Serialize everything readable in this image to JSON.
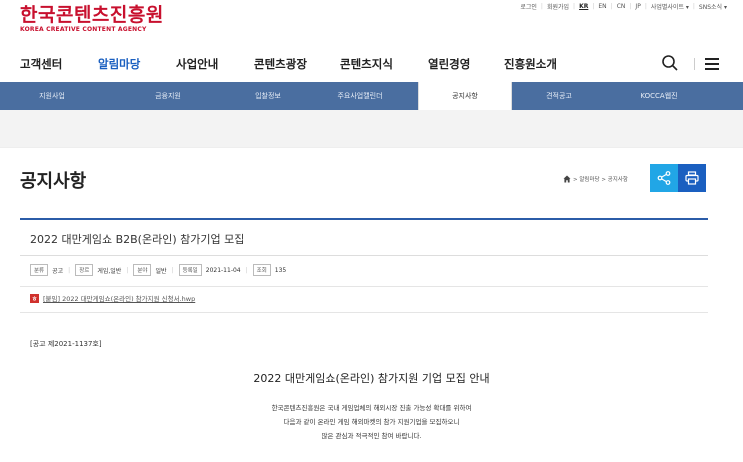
{
  "logo": {
    "ko": "한국콘텐츠진흥원",
    "en": "KOREA CREATIVE CONTENT AGENCY"
  },
  "util": [
    "로그인",
    "회원가입",
    "KR",
    "EN",
    "CN",
    "JP",
    "사업별사이트 ▾",
    "SNS소식 ▾"
  ],
  "gnb": [
    "고객센터",
    "알림마당",
    "사업안내",
    "콘텐츠광장",
    "콘텐츠지식",
    "열린경영",
    "진흥원소개"
  ],
  "lnb": [
    "지원사업",
    "금융지원",
    "입찰정보",
    "주요사업캘린더",
    "공지사항",
    "견적공고",
    "KOCCA웹진"
  ],
  "page": {
    "title": "공지사항",
    "breadcrumb": "> 알림마당 > 공지사항"
  },
  "article": {
    "title": "2022 대만게임쇼 B2B(온라인) 참가기업 모집",
    "meta": [
      {
        "label": "분류",
        "value": "공고"
      },
      {
        "label": "장르",
        "value": "게임,일반"
      },
      {
        "label": "분야",
        "value": "일반"
      },
      {
        "label": "등록일",
        "value": "2021-11-04"
      },
      {
        "label": "조회",
        "value": "135"
      }
    ],
    "attachment": "[붙임] 2022 대만게임쇼(온라인) 참가지원 신청서.hwp",
    "notice_no": "[공고 제2021-1137호]",
    "body_title": "2022 대만게임쇼(온라인) 참가지원 기업 모집 안내",
    "body_lines": [
      "한국콘텐츠진흥원은 국내 게임업체의 해외시장 진출 가능성 확대를 위하여",
      "다음과 같이 온라인 게임 해외마켓의 참가 지원기업을 모집하오니",
      "많은 관심과 적극적인 참여 바랍니다."
    ]
  },
  "colors": {
    "brand": "#c8102e",
    "nav_active": "#1a5fc0",
    "lnb_bg": "#4a6ea0",
    "share": "#21a6e6",
    "print": "#1a5fc0"
  }
}
